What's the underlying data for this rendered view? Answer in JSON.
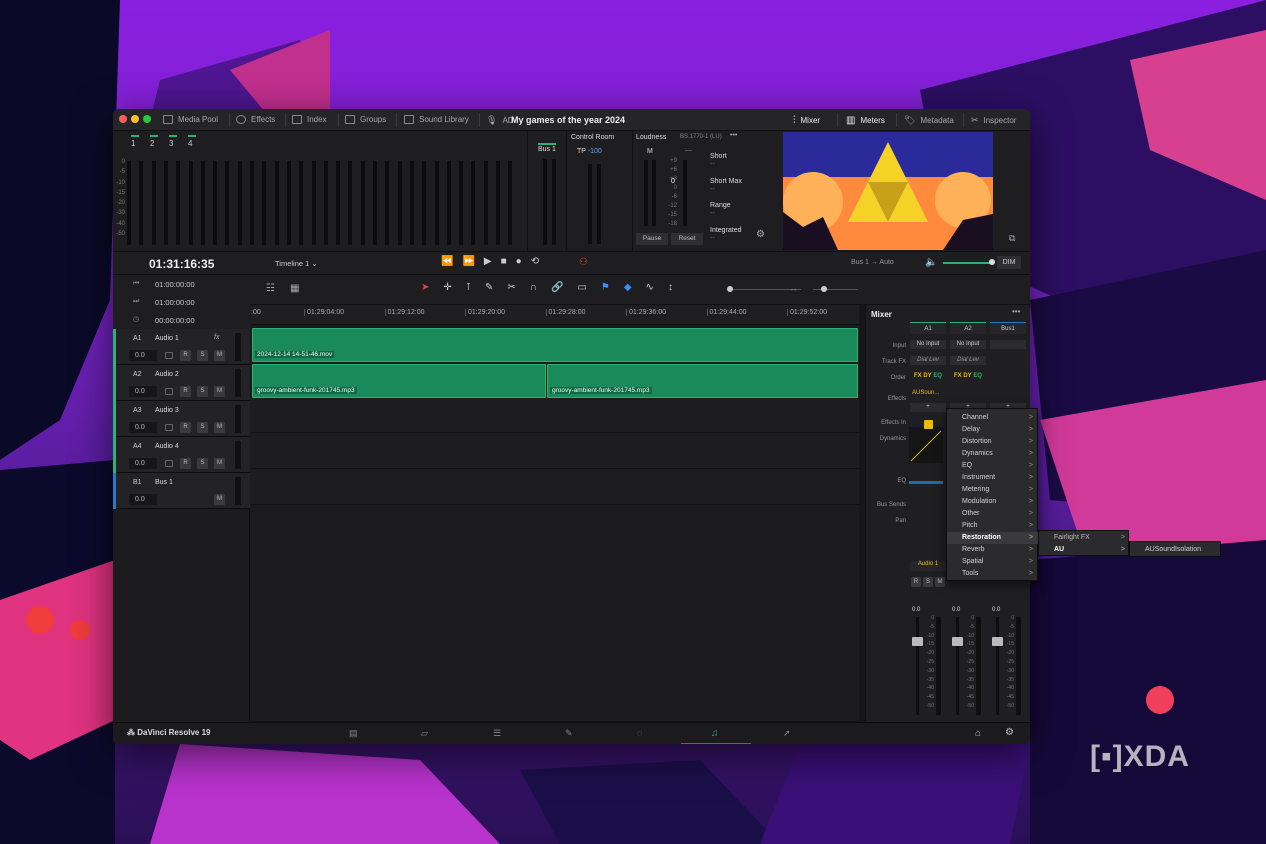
{
  "window_title": "My games of the year 2024",
  "toolbar": {
    "media_pool": "Media Pool",
    "effects": "Effects",
    "index": "Index",
    "groups": "Groups",
    "sound_library": "Sound Library",
    "ad_label": "AD",
    "mixer": "Mixer",
    "meters": "Meters",
    "metadata": "Metadata",
    "inspector": "Inspector"
  },
  "meter_channels": [
    "1",
    "2",
    "3",
    "4"
  ],
  "meter_scale": [
    "0",
    "-5",
    "-10",
    "-15",
    "-20",
    "-30",
    "-40",
    "-50"
  ],
  "bus_panel": {
    "label": "Bus 1",
    "scale": [
      "0",
      "-5",
      "-10",
      "-15",
      "-20",
      "-30",
      "-40",
      "-50"
    ]
  },
  "control_room": {
    "label": "Control Room",
    "tp_label": "TP",
    "tp_value": "-100"
  },
  "loudness": {
    "label": "Loudness",
    "standard": "BS.1770-1 (LU)",
    "m_label": "M",
    "m_dash": "—",
    "m_scale": [
      "+9",
      "+6",
      "+3",
      "0",
      "-6",
      "-12",
      "-15",
      "-18"
    ],
    "m_current": "0",
    "short": "Short",
    "short_max": "Short Max",
    "range": "Range",
    "integrated": "Integrated",
    "dash": "--",
    "pause": "Pause",
    "reset": "Reset"
  },
  "timecode": "01:31:16:35",
  "timeline_name": "Timeline 1",
  "output": {
    "bus": "Bus 1",
    "mode": "Auto",
    "dim": "DIM"
  },
  "transport_times": [
    "01:00:00:00",
    "01:00:00:00",
    "00:00:00:00"
  ],
  "ruler_ticks": [
    "01:29:04:00",
    "01:29:12:00",
    "01:29:20:00",
    "01:29:28:00",
    "01:29:36:00",
    "01:29:44:00",
    "01:29:52:00"
  ],
  "ruler_start": ":00",
  "tracks": [
    {
      "id": "A1",
      "name": "Audio 1",
      "vol": "0.0",
      "fx": "fx"
    },
    {
      "id": "A2",
      "name": "Audio 2",
      "vol": "0.0"
    },
    {
      "id": "A3",
      "name": "Audio 3",
      "vol": "0.0"
    },
    {
      "id": "A4",
      "name": "Audio 4",
      "vol": "0.0"
    },
    {
      "id": "B1",
      "name": "Bus 1",
      "vol": "0.0"
    }
  ],
  "track_buttons": {
    "r": "R",
    "s": "S",
    "m": "M"
  },
  "clips": {
    "a1": "2024-12-14 14-51-46.mov",
    "a2_1": "groovy-ambient-funk-201745.mp3",
    "a2_2": "groovy-ambient-funk-201745.mp3"
  },
  "mixer": {
    "title": "Mixer",
    "channels": [
      "A1",
      "A2",
      "Bus1"
    ],
    "rows": {
      "input": "Input",
      "track_fx": "Track FX",
      "order": "Order",
      "effects": "Effects",
      "effects_in": "Effects In",
      "dynamics": "Dynamics",
      "eq": "EQ",
      "bus_sends": "Bus Sends",
      "pan": "Pan"
    },
    "no_input": "No Input",
    "dial_lev": "Dial Lev",
    "order_fx": "FX",
    "order_dy": "DY",
    "order_eq": "EQ",
    "effect_slot": "AUSoun...",
    "add": "+",
    "bottom_name": "Audio 1",
    "fader_values": [
      "0.0",
      "0.0",
      "0.0"
    ],
    "fader_scale": [
      "0",
      "-5",
      "-10",
      "-15",
      "-20",
      "-25",
      "-30",
      "-35",
      "-40",
      "-45",
      "-50"
    ],
    "rsm": [
      "R",
      "S",
      "M"
    ]
  },
  "menu_items": [
    "Channel",
    "Delay",
    "Distortion",
    "Dynamics",
    "EQ",
    "Instrument",
    "Metering",
    "Modulation",
    "Other",
    "Pitch",
    "Restoration",
    "Reverb",
    "Spatial",
    "Tools"
  ],
  "submenu_items": [
    "Fairlight FX",
    "AU"
  ],
  "submenu2_items": [
    "AUSoundIsolation"
  ],
  "app_name": "DaVinci Resolve 19",
  "watermark": "XDA",
  "colors": {
    "accent": "#27b475",
    "clip": "#1a8a5b",
    "yellow": "#f2b90b",
    "viewer_sky": "#2b2a9a"
  }
}
